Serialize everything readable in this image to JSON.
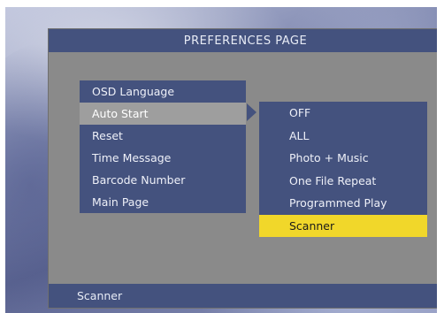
{
  "title": "PREFERENCES PAGE",
  "main_menu": {
    "items": [
      {
        "label": "OSD Language"
      },
      {
        "label": "Auto Start"
      },
      {
        "label": "Reset"
      },
      {
        "label": "Time Message"
      },
      {
        "label": "Barcode Number"
      },
      {
        "label": "Main Page"
      }
    ],
    "active_index": 1
  },
  "sub_menu": {
    "items": [
      {
        "label": "OFF"
      },
      {
        "label": "ALL"
      },
      {
        "label": "Photo + Music"
      },
      {
        "label": "One File Repeat"
      },
      {
        "label": "Programmed Play"
      },
      {
        "label": "Scanner"
      }
    ],
    "selected_index": 5
  },
  "status": {
    "text": "Scanner"
  },
  "colors": {
    "panel_blue": "#44527e",
    "panel_gray": "#8a8a8a",
    "highlight_gray": "#9e9e9e",
    "selection_yellow": "#f1d72a"
  },
  "icons": {
    "submenu_pointer": "triangle-right-icon"
  }
}
